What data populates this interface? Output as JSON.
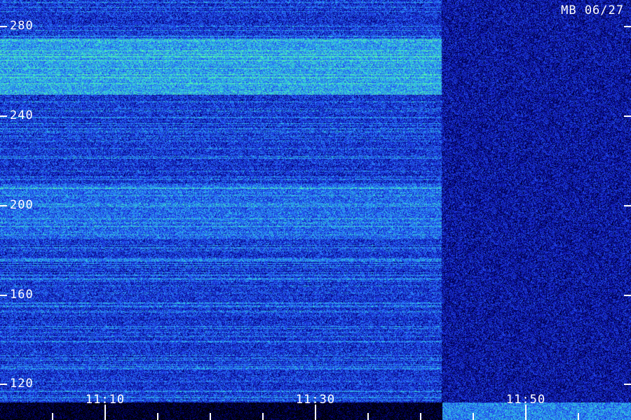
{
  "station_label": "MB 06/27",
  "chart_data": {
    "type": "heatmap",
    "title": "",
    "xlabel": "",
    "ylabel": "",
    "y_ticks": [
      120,
      160,
      200,
      240,
      280
    ],
    "ylim": [
      112,
      292
    ],
    "x_tick_labels": [
      "11:10",
      "11:30",
      "11:50"
    ],
    "x_major_ticks_minutes": [
      10,
      30,
      50
    ],
    "x_minor_step_minutes": 5,
    "xlim_minutes": [
      0,
      60
    ],
    "intensity_regions": [
      {
        "x_range_minutes": [
          0,
          42
        ],
        "y_range": [
          250,
          275
        ],
        "level": "high"
      },
      {
        "x_range_minutes": [
          0,
          42
        ],
        "y_range": [
          185,
          210
        ],
        "level": "medium"
      },
      {
        "x_range_minutes": [
          0,
          42
        ],
        "y_range": [
          112,
          292
        ],
        "level": "base"
      },
      {
        "x_range_minutes": [
          42,
          60
        ],
        "y_range": [
          112,
          292
        ],
        "level": "low"
      }
    ],
    "colormap": [
      "#000000",
      "#00006a",
      "#1a2ad8",
      "#2a7cff",
      "#33d6d6",
      "#66ff99"
    ],
    "grid": false,
    "legend": "none"
  }
}
